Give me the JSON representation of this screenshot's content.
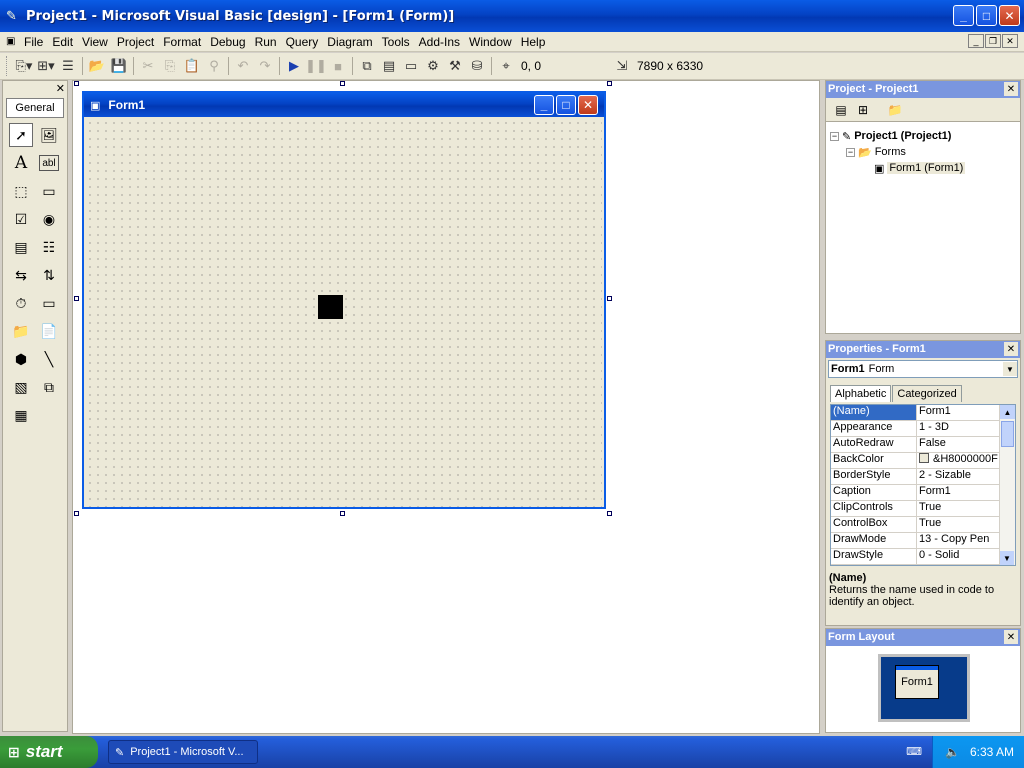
{
  "window": {
    "title": "Project1 - Microsoft Visual Basic [design] - [Form1 (Form)]",
    "controls": [
      "_",
      "□",
      "✕"
    ]
  },
  "menu": {
    "items": [
      "File",
      "Edit",
      "View",
      "Project",
      "Format",
      "Debug",
      "Run",
      "Query",
      "Diagram",
      "Tools",
      "Add-Ins",
      "Window",
      "Help"
    ],
    "mdi_controls": [
      "_",
      "❐",
      "✕"
    ]
  },
  "toolbar": {
    "position_readout": "0, 0",
    "size_readout": "7890 x 6330",
    "icons": [
      "add-project-icon",
      "add-form-icon",
      "menu-editor-icon",
      "open-icon",
      "save-icon",
      "cut-icon",
      "copy-icon",
      "paste-icon",
      "find-icon",
      "undo-icon",
      "redo-icon",
      "start-icon",
      "break-icon",
      "end-icon",
      "project-explorer-icon",
      "properties-icon",
      "form-layout-icon",
      "object-browser-icon",
      "toolbox-icon",
      "data-view-icon",
      "component-manager-icon"
    ]
  },
  "toolbox": {
    "tab": "General",
    "close": "✕",
    "label_tool_glyph": "A",
    "textbox_tool_glyph": "abl"
  },
  "form": {
    "title": "Form1"
  },
  "project_pane": {
    "title": "Project - Project1",
    "close": "✕",
    "tree": {
      "project": "Project1 (Project1)",
      "folder": "Forms",
      "form": "Form1 (Form1)"
    }
  },
  "properties_pane": {
    "title": "Properties - Form1",
    "close": "✕",
    "object_name": "Form1",
    "object_type": "Form",
    "tabs": [
      "Alphabetic",
      "Categorized"
    ],
    "rows": [
      {
        "name": "(Name)",
        "value": "Form1"
      },
      {
        "name": "Appearance",
        "value": "1 - 3D"
      },
      {
        "name": "AutoRedraw",
        "value": "False"
      },
      {
        "name": "BackColor",
        "value": "&H8000000F"
      },
      {
        "name": "BorderStyle",
        "value": "2 - Sizable"
      },
      {
        "name": "Caption",
        "value": "Form1"
      },
      {
        "name": "ClipControls",
        "value": "True"
      },
      {
        "name": "ControlBox",
        "value": "True"
      },
      {
        "name": "DrawMode",
        "value": "13 - Copy Pen"
      },
      {
        "name": "DrawStyle",
        "value": "0 - Solid"
      }
    ],
    "description_name": "(Name)",
    "description_text": "Returns the name used in code to identify an object."
  },
  "layout_pane": {
    "title": "Form Layout",
    "close": "✕",
    "mini_form": "Form1"
  },
  "taskbar": {
    "start": "start",
    "task": "Project1 - Microsoft V...",
    "clock": "6:33 AM"
  },
  "colors": {
    "title_blue": "#0442c4",
    "pane_title": "#7a96df",
    "selection": "#316ac5",
    "start_green": "#3a9c3a"
  }
}
